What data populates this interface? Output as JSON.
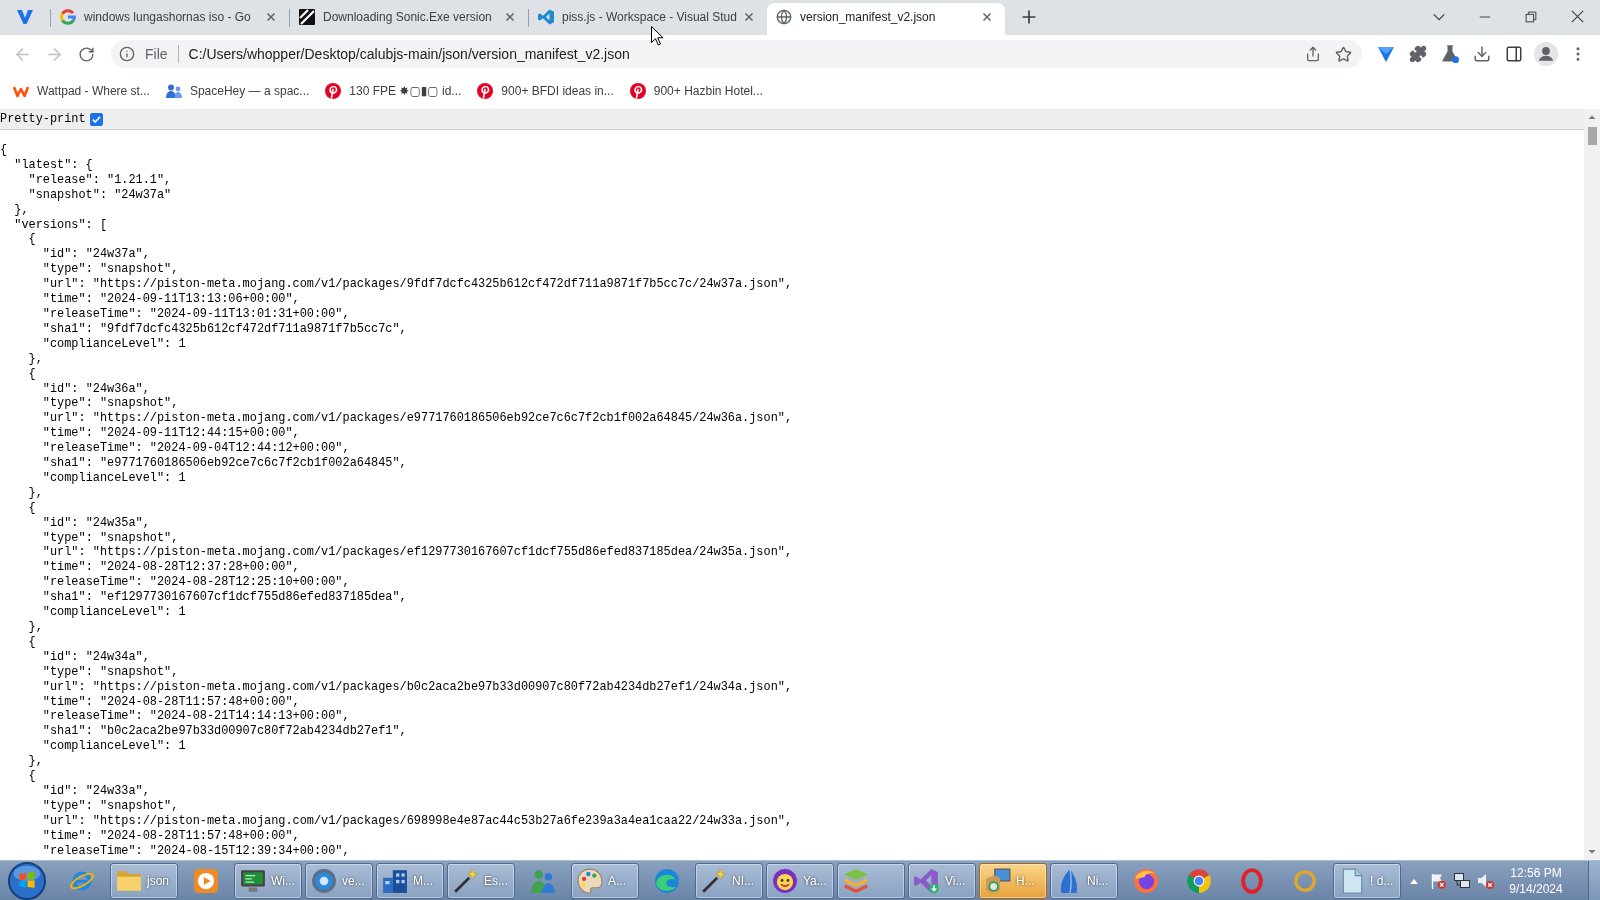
{
  "browser": {
    "tabs": [
      {
        "kind": "pinned",
        "selected": false
      },
      {
        "kind": "page",
        "title": "windows lungashornas iso - Go",
        "selected": false
      },
      {
        "kind": "page",
        "title": "Downloading Sonic.Exe version",
        "selected": false
      },
      {
        "kind": "page",
        "title": "piss.js - Workspace - Visual Stud",
        "selected": false
      },
      {
        "kind": "page",
        "title": "version_manifest_v2.json",
        "selected": true
      }
    ],
    "toolbar": {
      "back": {
        "disabled": true
      },
      "forward": {
        "disabled": true
      },
      "scheme": "File",
      "url": "C:/Users/whopper/Desktop/calubjs-main/json/version_manifest_v2.json"
    },
    "bookmarks": [
      "Wattpad - Where st...",
      "SpaceHey — a spac...",
      "130 FPE ✸▢▮▢ id...",
      "900+ BFDI ideas in...",
      "900+ Hazbin Hotel..."
    ]
  },
  "page": {
    "pretty_print": {
      "label": "Pretty-print",
      "checked": true
    },
    "json_view": {
      "open": "{",
      "children": [
        {
          "open": "\"latest\": {",
          "children": [
            {
              "text": "\"release\": \"1.21.1\","
            },
            {
              "text": "\"snapshot\": \"24w37a\""
            }
          ],
          "close": "},"
        },
        {
          "open": "\"versions\": [",
          "children": [
            {
              "open": "{",
              "children": [
                {
                  "text": "\"id\": \"24w37a\","
                },
                {
                  "text": "\"type\": \"snapshot\","
                },
                {
                  "text": "\"url\": \"https://piston-meta.mojang.com/v1/packages/9fdf7dcfc4325b612cf472df711a9871f7b5cc7c/24w37a.json\","
                },
                {
                  "text": "\"time\": \"2024-09-11T13:13:06+00:00\","
                },
                {
                  "text": "\"releaseTime\": \"2024-09-11T13:01:31+00:00\","
                },
                {
                  "text": "\"sha1\": \"9fdf7dcfc4325b612cf472df711a9871f7b5cc7c\","
                },
                {
                  "text": "\"complianceLevel\": 1"
                }
              ],
              "close": "},"
            },
            {
              "open": "{",
              "children": [
                {
                  "text": "\"id\": \"24w36a\","
                },
                {
                  "text": "\"type\": \"snapshot\","
                },
                {
                  "text": "\"url\": \"https://piston-meta.mojang.com/v1/packages/e9771760186506eb92ce7c6c7f2cb1f002a64845/24w36a.json\","
                },
                {
                  "text": "\"time\": \"2024-09-11T12:44:15+00:00\","
                },
                {
                  "text": "\"releaseTime\": \"2024-09-04T12:44:12+00:00\","
                },
                {
                  "text": "\"sha1\": \"e9771760186506eb92ce7c6c7f2cb1f002a64845\","
                },
                {
                  "text": "\"complianceLevel\": 1"
                }
              ],
              "close": "},"
            },
            {
              "open": "{",
              "children": [
                {
                  "text": "\"id\": \"24w35a\","
                },
                {
                  "text": "\"type\": \"snapshot\","
                },
                {
                  "text": "\"url\": \"https://piston-meta.mojang.com/v1/packages/ef1297730167607cf1dcf755d86efed837185dea/24w35a.json\","
                },
                {
                  "text": "\"time\": \"2024-08-28T12:37:28+00:00\","
                },
                {
                  "text": "\"releaseTime\": \"2024-08-28T12:25:10+00:00\","
                },
                {
                  "text": "\"sha1\": \"ef1297730167607cf1dcf755d86efed837185dea\","
                },
                {
                  "text": "\"complianceLevel\": 1"
                }
              ],
              "close": "},"
            },
            {
              "open": "{",
              "children": [
                {
                  "text": "\"id\": \"24w34a\","
                },
                {
                  "text": "\"type\": \"snapshot\","
                },
                {
                  "text": "\"url\": \"https://piston-meta.mojang.com/v1/packages/b0c2aca2be97b33d00907c80f72ab4234db27ef1/24w34a.json\","
                },
                {
                  "text": "\"time\": \"2024-08-28T11:57:48+00:00\","
                },
                {
                  "text": "\"releaseTime\": \"2024-08-21T14:14:13+00:00\","
                },
                {
                  "text": "\"sha1\": \"b0c2aca2be97b33d00907c80f72ab4234db27ef1\","
                },
                {
                  "text": "\"complianceLevel\": 1"
                }
              ],
              "close": "},"
            },
            {
              "open": "{",
              "children": [
                {
                  "text": "\"id\": \"24w33a\","
                },
                {
                  "text": "\"type\": \"snapshot\","
                },
                {
                  "text": "\"url\": \"https://piston-meta.mojang.com/v1/packages/698998e4e87ac44c53b27a6fe239a3a4ea1caa22/24w33a.json\","
                },
                {
                  "text": "\"time\": \"2024-08-28T11:57:48+00:00\","
                },
                {
                  "text": "\"releaseTime\": \"2024-08-15T12:39:34+00:00\","
                }
              ]
            }
          ]
        }
      ]
    }
  },
  "taskbar": {
    "items": [
      {
        "kind": "pinned"
      },
      {
        "kind": "window",
        "label": "json",
        "flashing": false
      },
      {
        "kind": "pinned"
      },
      {
        "kind": "window",
        "label": "Wi...",
        "flashing": false
      },
      {
        "kind": "window",
        "label": "ve...",
        "flashing": false
      },
      {
        "kind": "window",
        "label": "M...",
        "flashing": false
      },
      {
        "kind": "window",
        "label": "Es...",
        "flashing": false
      },
      {
        "kind": "pinned"
      },
      {
        "kind": "window",
        "label": "A...",
        "flashing": false
      },
      {
        "kind": "pinned"
      },
      {
        "kind": "window",
        "label": "NI...",
        "flashing": false
      },
      {
        "kind": "window",
        "label": "Ya...",
        "flashing": false
      },
      {
        "kind": "window",
        "flashing": false
      },
      {
        "kind": "window",
        "label": "Vi...",
        "flashing": false
      },
      {
        "kind": "window",
        "label": "H...",
        "flashing": true
      },
      {
        "kind": "window",
        "label": "Ni...",
        "flashing": false
      },
      {
        "kind": "pinned"
      },
      {
        "kind": "pinned"
      },
      {
        "kind": "pinned"
      },
      {
        "kind": "pinned"
      },
      {
        "kind": "window",
        "label": "! d...",
        "flashing": false
      }
    ],
    "clock": {
      "time": "12:56 PM",
      "date": "9/14/2024"
    }
  }
}
